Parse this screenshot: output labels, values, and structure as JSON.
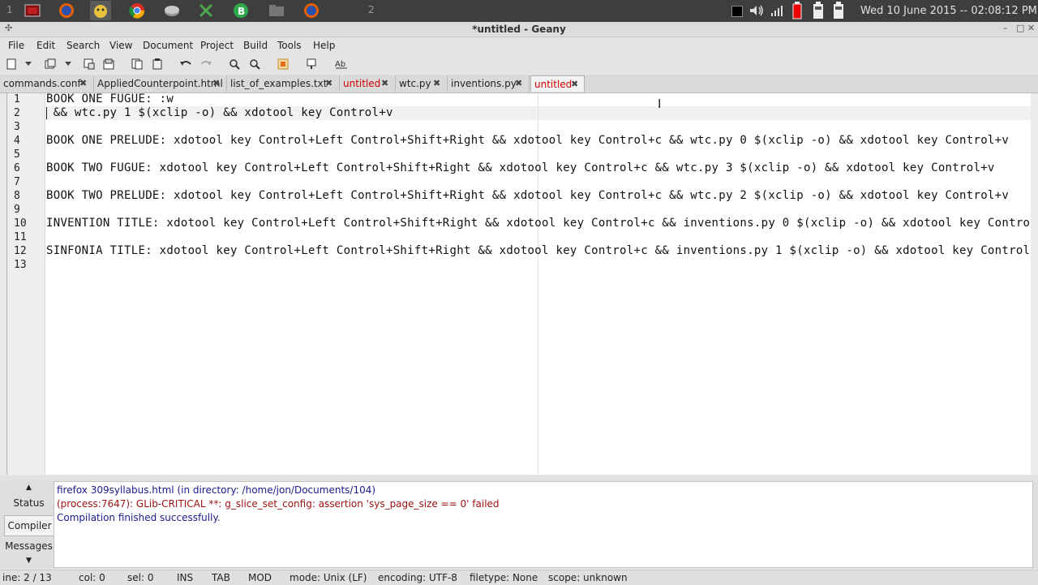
{
  "panel": {
    "workspace_1": "1",
    "workspace_2": "2",
    "clock": "Wed 10 June 2015 -- 02:08:12 PM"
  },
  "window": {
    "title": "*untitled - Geany"
  },
  "menubar": [
    "File",
    "Edit",
    "Search",
    "View",
    "Document",
    "Project",
    "Build",
    "Tools",
    "Help"
  ],
  "tabs": [
    {
      "label": "commands.conf",
      "modified": false,
      "active": false
    },
    {
      "label": "AppliedCounterpoint.html",
      "modified": false,
      "active": false
    },
    {
      "label": "list_of_examples.txt",
      "modified": false,
      "active": false
    },
    {
      "label": "untitled",
      "modified": true,
      "active": false
    },
    {
      "label": "wtc.py",
      "modified": false,
      "active": false
    },
    {
      "label": "inventions.py",
      "modified": false,
      "active": false
    },
    {
      "label": "untitled",
      "modified": true,
      "active": true
    }
  ],
  "editor": {
    "lines": [
      {
        "num": "1",
        "text": "BOOK ONE FUGUE: :w"
      },
      {
        "num": "2",
        "text": " && wtc.py 1 $(xclip -o) && xdotool key Control+v"
      },
      {
        "num": "3",
        "text": ""
      },
      {
        "num": "4",
        "text": "BOOK ONE PRELUDE: xdotool key Control+Left Control+Shift+Right && xdotool key Control+c && wtc.py 0 $(xclip -o) && xdotool key Control+v"
      },
      {
        "num": "5",
        "text": ""
      },
      {
        "num": "6",
        "text": "BOOK TWO FUGUE: xdotool key Control+Left Control+Shift+Right && xdotool key Control+c && wtc.py 3 $(xclip -o) && xdotool key Control+v"
      },
      {
        "num": "7",
        "text": ""
      },
      {
        "num": "8",
        "text": "BOOK TWO PRELUDE: xdotool key Control+Left Control+Shift+Right && xdotool key Control+c && wtc.py 2 $(xclip -o) && xdotool key Control+v"
      },
      {
        "num": "9",
        "text": ""
      },
      {
        "num": "10",
        "text": "INVENTION TITLE: xdotool key Control+Left Control+Shift+Right && xdotool key Control+c && inventions.py 0 $(xclip -o) && xdotool key Control+v"
      },
      {
        "num": "11",
        "text": ""
      },
      {
        "num": "12",
        "text": "SINFONIA TITLE: xdotool key Control+Left Control+Shift+Right && xdotool key Control+c && inventions.py 1 $(xclip -o) && xdotool key Control+v"
      },
      {
        "num": "13",
        "text": ""
      }
    ]
  },
  "message_window": {
    "tabs": [
      "Status",
      "Compiler",
      "Messages"
    ],
    "active_tab": "Compiler",
    "messages": [
      {
        "text": "firefox 309syllabus.html (in directory: /home/jon/Documents/104)",
        "color": "#1a1a8c"
      },
      {
        "text": "(process:7647): GLib-CRITICAL **: g_slice_set_config: assertion 'sys_page_size == 0' failed",
        "color": "#9c1010"
      },
      {
        "text": "Compilation finished successfully.",
        "color": "#1a1a8c"
      }
    ]
  },
  "statusbar": {
    "line": "ine: 2 / 13",
    "col": "col: 0",
    "sel": "sel: 0",
    "ins": "INS",
    "tab": "TAB",
    "mod": "MOD",
    "mode": "mode: Unix (LF)",
    "encoding": "encoding: UTF-8",
    "filetype": "filetype: None",
    "scope": "scope: unknown"
  }
}
